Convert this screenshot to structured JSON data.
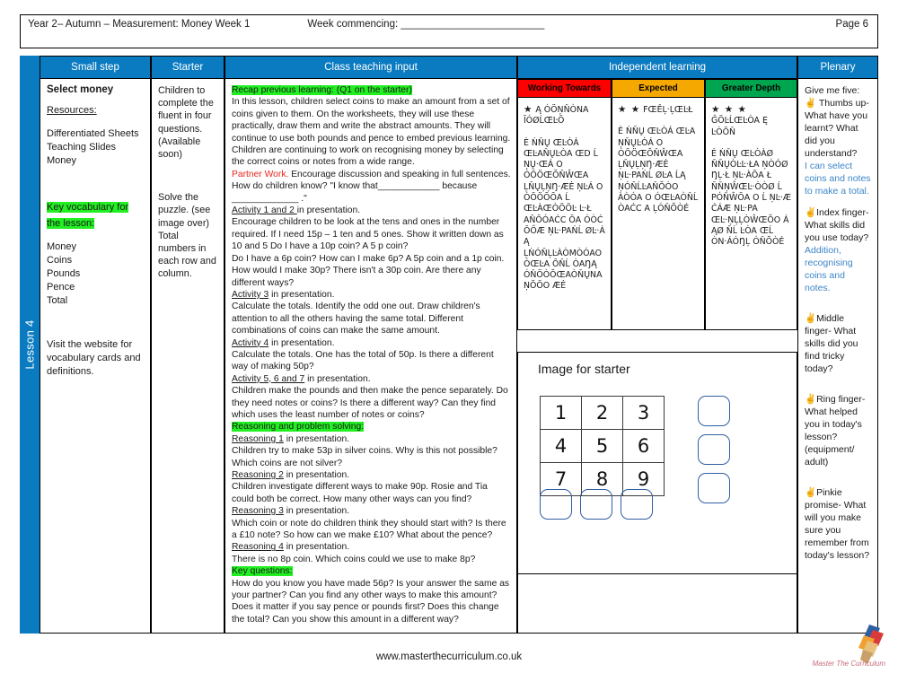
{
  "header": {
    "title": "Year 2– Autumn – Measurement: Money  Week 1",
    "week_commencing": "Week commencing: _________________________",
    "page": "Page 6"
  },
  "spine": {
    "label": "Lesson 4"
  },
  "columns": {
    "small_step": "Small step",
    "starter": "Starter",
    "class_teaching_input": "Class teaching input",
    "independent_learning": "Independent learning",
    "plenary": "Plenary"
  },
  "small_step": {
    "title": "Select money",
    "resources_label": "Resources:",
    "resources": [
      "Differentiated Sheets",
      "Teaching Slides",
      "Money"
    ],
    "vocab_heading": "Key vocabulary for the lesson:",
    "vocab": [
      "Money",
      "Coins",
      "Pounds",
      "Pence",
      "Total"
    ],
    "website_note": "Visit the website for vocabulary cards and definitions."
  },
  "starter": {
    "para1": "Children to complete the fluent in four questions. (Available soon)",
    "para2": "Solve the puzzle. (see image over) Total numbers in each row and column."
  },
  "teaching": {
    "recap_heading": "Recap previous learning: (Q1 on the starter)",
    "recap_body": "In this lesson, children select coins to make an amount from a set of coins given to them. On the worksheets, they will use these practically, draw them and write the abstract amounts. They will continue to use both pounds and pence to embed previous learning. Children are continuing to work on recognising money by selecting the correct coins or notes from a wide range.",
    "partner_label": "Partner Work.",
    "partner_body": " Encourage discussion and speaking in full sentences. How do children know?  \"I know that____________  because _____________ .\"",
    "act12_label": "Activity 1 and 2 ",
    "act12_tail": "in presentation.",
    "act12_body": "Encourage children to be look at the tens and ones in the number required. If I need 15p – 1 ten and 5 ones. Show it written down as 10  and 5  Do I have a 10p coin? A 5 p coin?",
    "act12_body2": "Do I have a 6p coin? How can I make 6p?  A 5p coin and a 1p coin. How would I make 30p? There isn't a 30p coin. Are there any different ways?",
    "act3_label": "Activity 3",
    "act3_tail": " in presentation.",
    "act3_body": "Calculate the totals. Identify the odd one out. Draw children's attention to all the others having the same total. Different combinations of coins can make the same amount.",
    "act4_label": "Activity 4",
    "act4_tail": " in presentation.",
    "act4_body": "Calculate the totals. One has the total of 50p. Is there a different way of making 50p?",
    "act567_label": "Activity 5, 6 and 7",
    "act567_tail": " in presentation.",
    "act567_body": "Children make the pounds and then make the pence separately. Do they need notes or coins? Is there a different way? Can they find which uses the least number of notes or coins?",
    "reasoning_heading": "Reasoning and problem solving:",
    "r1_label": "Reasoning 1",
    "r1_tail": " in presentation.",
    "r1_body": "Children try to make 53p in silver coins. Why is this not possible? Which coins are not silver?",
    "r2_label": "Reasoning 2",
    "r2_tail": " in presentation.",
    "r2_body": "Children investigate different ways to make 90p. Rosie and Tia could both be correct. How many other ways can you find?",
    "r3_label": "Reasoning 3",
    "r3_tail": " in presentation.",
    "r3_body": "Which coin or note do children think they should start with? Is there a £10 note? So how can we make £10? What about the pence?",
    "r4_label": "Reasoning 4",
    "r4_tail": " in presentation.",
    "r4_body": "There is no 8p coin. Which coins could we use to make 8p?",
    "key_questions_heading": "Key questions:",
    "key_questions_body": "How do you know you have made 56p? Is your answer the same as your partner? Can you find any other ways to make this amount? Does it matter if you say pence or pounds first? Does this change the total? Can you show this amount in a different way?"
  },
  "rag": {
    "working_towards": {
      "label": "Working Towards",
      "color": "#ff0000",
      "stars": "★",
      "title_garbled": "Ą  ÓÖŅŇÒNA ĪÓØĹŒĿŌ",
      "body_garbled": "Ė ŃŇŲ ŒĿÒÁ ŒĿAŇŲĿÒA ŒD Ĺ ŅŲ·ŒÁ O ÓŌÖŒŎŇŴŒA ĻŇŲĻŅŊ·ÆĖ ŅĿÁ O ÓŌÖŌŌA Ĺ ŒĿÀŒÒÖÖĿ Ŀ·Ł AŇŌÓAĊC ŌA ÓÒĊ ŌŐÆ ŅĿ·PAŃĹ ØĿ·Á Ą ĻŃÓŇĻĿÀÒMÒÓAO ÓŒĿA ŌŇĹ ÒAŊĄ ÓŇÖÒŎŒAÒŇŲNA ŅŎŌO ÆĖ"
    },
    "expected": {
      "label": "Expected",
      "color": "#f5a800",
      "stars": "★ ★",
      "title_garbled": "FŒÊĻ·ĻŒĿŁ",
      "body_garbled": "Ė ŃŇŲ ŒĿÒÁ ŒĿA ŅŇŲĿÒÁ O ÓŌÖŒŎŇŴŒA ĻŇŲĻŅŊ·ÆĖ ŅĿ·PAŃĹ ØĿA ĹĄ ŅÓŇĹĿAŇŎÒO ÀÒÓA O ÓŒĿAÒŇĹ ÒAĊC A ĻÓŇŎÒÉ"
    },
    "greater_depth": {
      "label": "Greater Depth",
      "color": "#00a550",
      "stars": "★ ★ ★",
      "title_garbled": "ĜÖĿĹŒĿÒA Ę ĿÒÖŇ",
      "body_garbled": "Ė ŃŇŲ ŒĿÒÀØ ŇŇŲÒĿĿ·ŁA ŅÒÓØ ŊĻ·Ł ŅĿ·ÀŌA Ł ŇŇŅŴŒĿ·ÒÒØ Ĺ PÓŇŴŌA O Ĺ ŅĿ·Æ ĊÁÆ ŅĿ·PA ŒĿ·ŅĻĻÒŴŒŎO Á ĄØ ŇĹ ĿÒA ŒĹ ÒN·ÁÓŊĻ ÓŇŎÒÉ"
    }
  },
  "image_panel": {
    "title": "Image for starter",
    "grid": [
      [
        "1",
        "2",
        "3"
      ],
      [
        "4",
        "5",
        "6"
      ],
      [
        "7",
        "8",
        "9"
      ]
    ],
    "row_totals": [
      "",
      "",
      ""
    ],
    "col_totals": [
      "",
      "",
      ""
    ]
  },
  "plenary": {
    "intro": "Give me five:",
    "items": [
      {
        "icon": "hand-icon",
        "prompt": "Thumbs up- What have you learnt? What did you understand?",
        "answer": "I can select coins and notes to make a total."
      },
      {
        "icon": "hand-icon",
        "prompt": "Index finger- What skills did you use today?",
        "answer": "Addition, recognising coins and notes."
      },
      {
        "icon": "hand-icon",
        "prompt": "Middle finger- What skills did you find tricky today?",
        "answer": ""
      },
      {
        "icon": "hand-icon",
        "prompt": "Ring finger- What helped you in today's lesson? (equipment/ adult)",
        "answer": ""
      },
      {
        "icon": "hand-icon",
        "prompt": "Pinkie promise- What will you make sure you remember from today's lesson?",
        "answer": ""
      }
    ]
  },
  "footer": {
    "site": "www.masterthecurriculum.co.uk",
    "logo_text": "Master The Curriculum"
  }
}
